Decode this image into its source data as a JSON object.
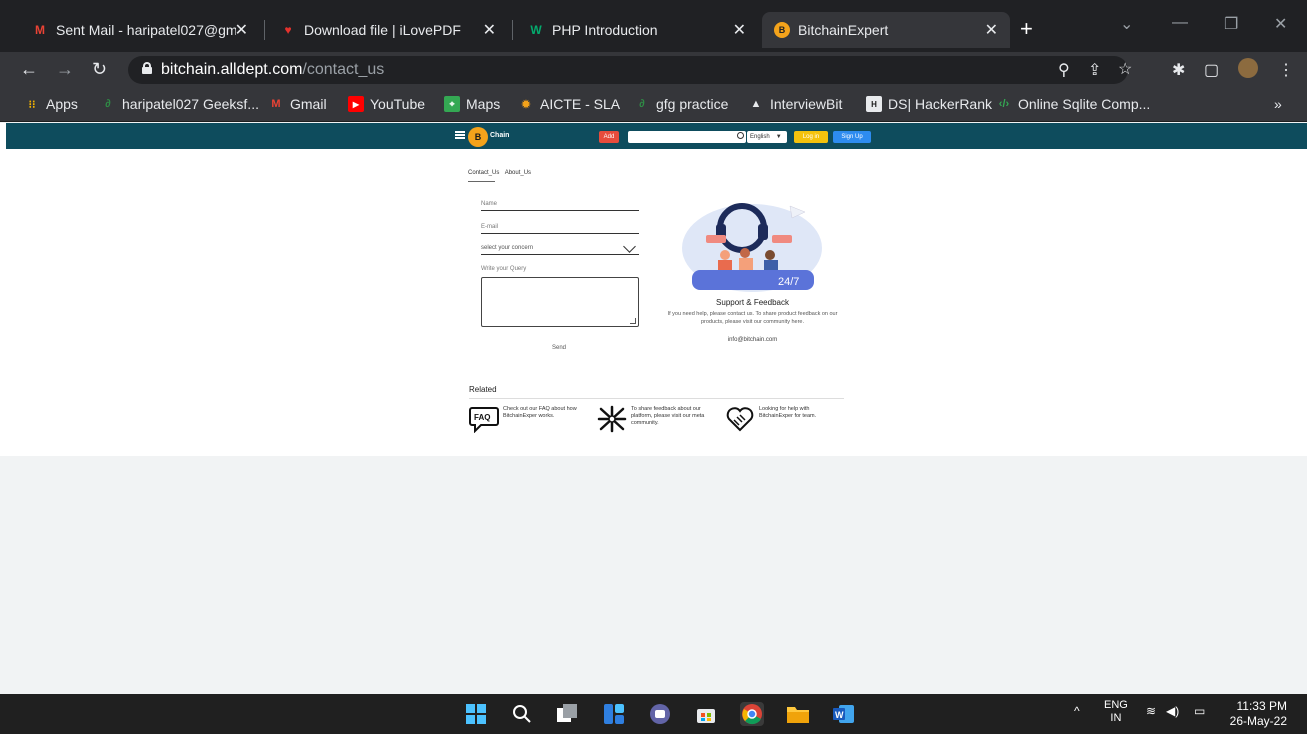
{
  "browser": {
    "tabs": [
      {
        "title": "Sent Mail - haripatel027@gma",
        "icon": "gmail-icon"
      },
      {
        "title": "Download file | iLovePDF",
        "icon": "ilovepdf-icon"
      },
      {
        "title": "PHP Introduction",
        "icon": "w3schools-icon"
      },
      {
        "title": "BitchainExpert",
        "icon": "bitchain-icon"
      }
    ],
    "new_tab_label": "+",
    "url_host": "bitchain.alldept.com",
    "url_path": "/contact_us",
    "bookmarks": [
      {
        "label": "Apps",
        "icon": "apps-grid-icon"
      },
      {
        "label": "haripatel027 Geeksf...",
        "icon": "gfg-icon"
      },
      {
        "label": "Gmail",
        "icon": "gmail-icon"
      },
      {
        "label": "YouTube",
        "icon": "youtube-icon"
      },
      {
        "label": "Maps",
        "icon": "maps-icon"
      },
      {
        "label": "AICTE - SLA",
        "icon": "aicte-icon"
      },
      {
        "label": "gfg practice",
        "icon": "gfg-icon"
      },
      {
        "label": "InterviewBit",
        "icon": "interviewbit-icon"
      },
      {
        "label": "DS| HackerRank",
        "icon": "hackerrank-icon"
      },
      {
        "label": "Online Sqlite Comp...",
        "icon": "code-icon"
      }
    ],
    "bookmarks_overflow": "»"
  },
  "site": {
    "logo_text": "Chain",
    "add_label": "Add",
    "language": "English",
    "login_label": "Log in",
    "signup_label": "Sign Up",
    "tabs": [
      "Contact_Us",
      "About_Us"
    ],
    "form": {
      "name_label": "Name",
      "email_label": "E-mail",
      "concern_placeholder": "select your concern",
      "query_label": "Write your Query",
      "send_label": "Send"
    },
    "support": {
      "title": "Support & Feedback",
      "description": "If you need help, please contact us. To share product feedback on our products, please visit our community here.",
      "email": "info@bitchain.com",
      "badge": "24/7"
    },
    "related": {
      "title": "Related",
      "items": [
        {
          "icon": "faq-icon",
          "icon_label": "FAQ",
          "text": "Check out our FAQ about how BitchainExper works."
        },
        {
          "icon": "community-icon",
          "text": "To share feedback about our platform, please visit our meta community."
        },
        {
          "icon": "handshake-heart-icon",
          "text": "Looking for help with BitchainExper for team."
        }
      ]
    }
  },
  "taskbar": {
    "lang_top": "ENG",
    "lang_bottom": "IN",
    "time": "11:33 PM",
    "date": "26-May-22"
  },
  "colors": {
    "site_nav": "#0e4c5d",
    "chrome_dark": "#202124",
    "chrome_toolbar": "#35363a",
    "accent_yellow": "#f4a31b"
  }
}
